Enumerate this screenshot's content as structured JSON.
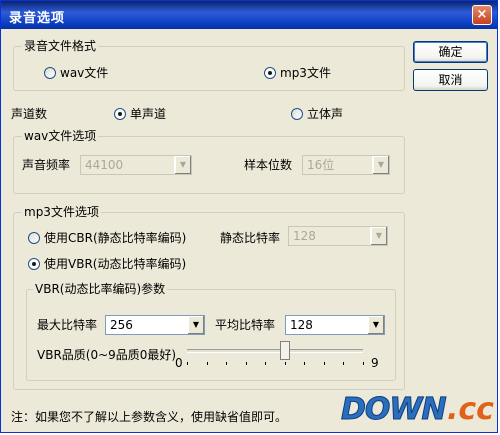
{
  "window": {
    "title": "录音选项",
    "close_glyph": "×"
  },
  "buttons": {
    "ok": "确定",
    "cancel": "取消"
  },
  "file_format": {
    "legend": "录音文件格式",
    "wav_label": "wav文件",
    "mp3_label": "mp3文件",
    "selected": "mp3"
  },
  "channels": {
    "label": "声道数",
    "mono_label": "单声道",
    "stereo_label": "立体声",
    "selected": "mono"
  },
  "wav_options": {
    "legend": "wav文件选项",
    "sample_rate_label": "声音频率",
    "sample_rate_value": "44100",
    "bits_label": "样本位数",
    "bits_value": "16位"
  },
  "mp3_options": {
    "legend": "mp3文件选项",
    "cbr_label": "使用CBR(静态比特率编码)",
    "static_bitrate_label": "静态比特率",
    "static_bitrate_value": "128",
    "vbr_label": "使用VBR(动态比特率编码)",
    "selected": "vbr",
    "vbr_params": {
      "legend": "VBR(动态比率编码)参数",
      "max_bitrate_label": "最大比特率",
      "max_bitrate_value": "256",
      "avg_bitrate_label": "平均比特率",
      "avg_bitrate_value": "128",
      "quality_label": "VBR品质(0~9品质0最好)",
      "slider_min": "0",
      "slider_max": "9",
      "slider_value": 5
    }
  },
  "note": "注：如果您不了解以上参数含义，使用缺省值即可。",
  "watermark": {
    "down": "DOWN",
    "cc": ".cc"
  },
  "icons": {
    "dropdown": "down-triangle-icon",
    "close": "close-icon"
  }
}
